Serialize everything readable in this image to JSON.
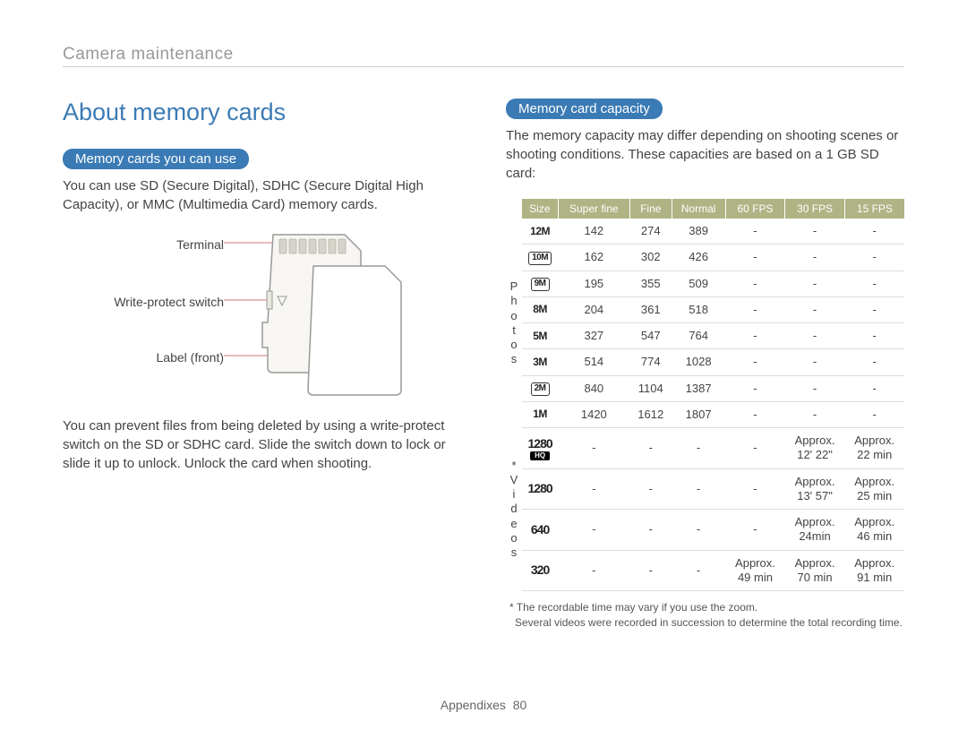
{
  "breadcrumb": "Camera maintenance",
  "page_title": "About memory cards",
  "section_use": {
    "heading": "Memory cards you can use",
    "p1": "You can use SD (Secure Digital), SDHC (Secure Digital High Capacity), or MMC (Multimedia Card) memory cards.",
    "diagram": {
      "terminal": "Terminal",
      "write_protect": "Write-protect switch",
      "label_front": "Label (front)"
    },
    "p2": "You can prevent files from being deleted by using a write-protect switch on the SD or SDHC card. Slide the switch down to lock or slide it up to unlock. Unlock the card when shooting."
  },
  "section_capacity": {
    "heading": "Memory card capacity",
    "intro": "The memory capacity may differ depending on shooting scenes or shooting conditions. These capacities are based on a 1 GB SD card:",
    "columns": [
      "Size",
      "Super fine",
      "Fine",
      "Normal",
      "60 FPS",
      "30 FPS",
      "15 FPS"
    ],
    "side_photos": "P\nh\no\nt\no\ns",
    "side_videos": "*\nV\ni\nd\ne\no\ns",
    "rows_photos": [
      {
        "size": "12M",
        "style": "plain",
        "sf": "142",
        "fine": "274",
        "normal": "389",
        "f60": "-",
        "f30": "-",
        "f15": "-"
      },
      {
        "size": "10M",
        "style": "boxed",
        "sf": "162",
        "fine": "302",
        "normal": "426",
        "f60": "-",
        "f30": "-",
        "f15": "-"
      },
      {
        "size": "9M",
        "style": "boxed",
        "sf": "195",
        "fine": "355",
        "normal": "509",
        "f60": "-",
        "f30": "-",
        "f15": "-"
      },
      {
        "size": "8M",
        "style": "plain",
        "sf": "204",
        "fine": "361",
        "normal": "518",
        "f60": "-",
        "f30": "-",
        "f15": "-"
      },
      {
        "size": "5M",
        "style": "plain",
        "sf": "327",
        "fine": "547",
        "normal": "764",
        "f60": "-",
        "f30": "-",
        "f15": "-"
      },
      {
        "size": "3M",
        "style": "plain",
        "sf": "514",
        "fine": "774",
        "normal": "1028",
        "f60": "-",
        "f30": "-",
        "f15": "-"
      },
      {
        "size": "2M",
        "style": "boxed",
        "sf": "840",
        "fine": "1104",
        "normal": "1387",
        "f60": "-",
        "f30": "-",
        "f15": "-"
      },
      {
        "size": "1M",
        "style": "plain",
        "sf": "1420",
        "fine": "1612",
        "normal": "1807",
        "f60": "-",
        "f30": "-",
        "f15": "-"
      }
    ],
    "rows_videos": [
      {
        "size": "1280",
        "sub": "HQ",
        "sf": "-",
        "fine": "-",
        "normal": "-",
        "f60": "-",
        "f30": "Approx. 12' 22\"",
        "f15": "Approx. 22 min"
      },
      {
        "size": "1280",
        "sub": "",
        "sf": "-",
        "fine": "-",
        "normal": "-",
        "f60": "-",
        "f30": "Approx. 13' 57\"",
        "f15": "Approx. 25 min"
      },
      {
        "size": "640",
        "sub": "",
        "sf": "-",
        "fine": "-",
        "normal": "-",
        "f60": "-",
        "f30": "Approx. 24min",
        "f15": "Approx. 46 min"
      },
      {
        "size": "320",
        "sub": "",
        "sf": "-",
        "fine": "-",
        "normal": "-",
        "f60": "Approx. 49 min",
        "f30": "Approx. 70 min",
        "f15": "Approx. 91 min"
      }
    ],
    "footnote": "* The recordable time may vary if you use the zoom.\nSeveral videos were recorded in succession to determine the total recording time."
  },
  "footer": {
    "section": "Appendixes",
    "page": "80"
  }
}
